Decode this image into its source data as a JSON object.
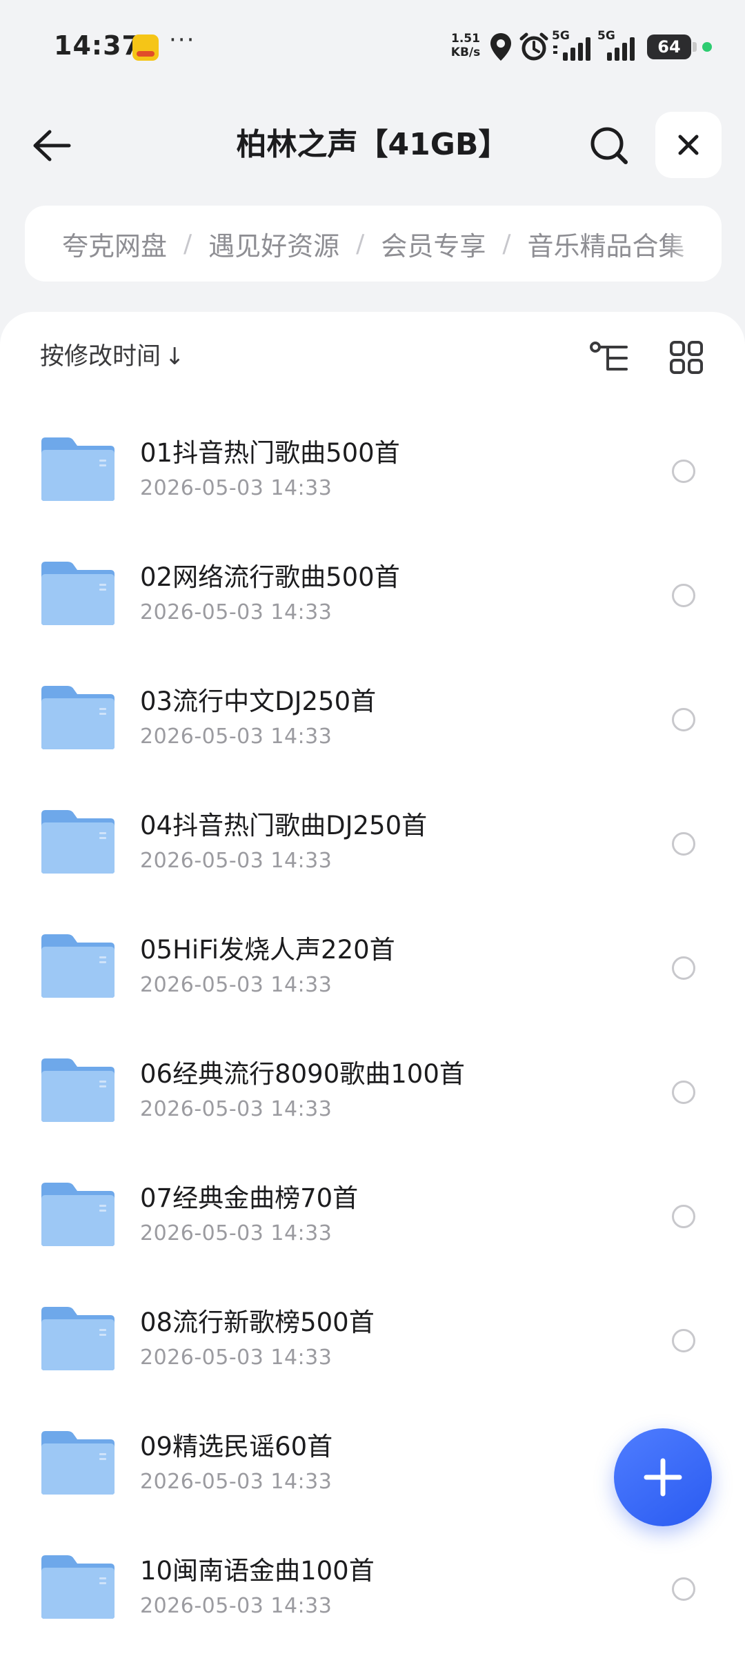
{
  "status_bar": {
    "time": "14:37",
    "network_speed_value": "1.51",
    "network_speed_unit": "KB/s",
    "signal_1_label": "5G",
    "signal_2_label": "5G",
    "battery_level": "64"
  },
  "header": {
    "title": "柏林之声【41GB】"
  },
  "breadcrumb": {
    "items": [
      "夸克网盘",
      "遇见好资源",
      "会员专享",
      "音乐精品合集"
    ],
    "separator": "/"
  },
  "toolbar": {
    "sort_label": "按修改时间",
    "sort_arrow": "↓"
  },
  "files": [
    {
      "name": "01抖音热门歌曲500首",
      "date": "2026-05-03 14:33"
    },
    {
      "name": "02网络流行歌曲500首",
      "date": "2026-05-03 14:33"
    },
    {
      "name": "03流行中文DJ250首",
      "date": "2026-05-03 14:33"
    },
    {
      "name": "04抖音热门歌曲DJ250首",
      "date": "2026-05-03 14:33"
    },
    {
      "name": "05HiFi发烧人声220首",
      "date": "2026-05-03 14:33"
    },
    {
      "name": "06经典流行8090歌曲100首",
      "date": "2026-05-03 14:33"
    },
    {
      "name": "07经典金曲榜70首",
      "date": "2026-05-03 14:33"
    },
    {
      "name": "08流行新歌榜500首",
      "date": "2026-05-03 14:33"
    },
    {
      "name": "09精选民谣60首",
      "date": "2026-05-03 14:33"
    },
    {
      "name": "10闽南语金曲100首",
      "date": "2026-05-03 14:33"
    }
  ],
  "icons": {
    "back": "arrow-left-icon",
    "search": "search-icon",
    "close": "close-icon",
    "tree_view": "tree-view-icon",
    "grid_view": "grid-view-icon",
    "folder": "folder-icon",
    "add": "plus-icon"
  },
  "colors": {
    "accent": "#2f63f5",
    "folder": "#8fc0f2",
    "page_bg": "#f2f3f5"
  }
}
